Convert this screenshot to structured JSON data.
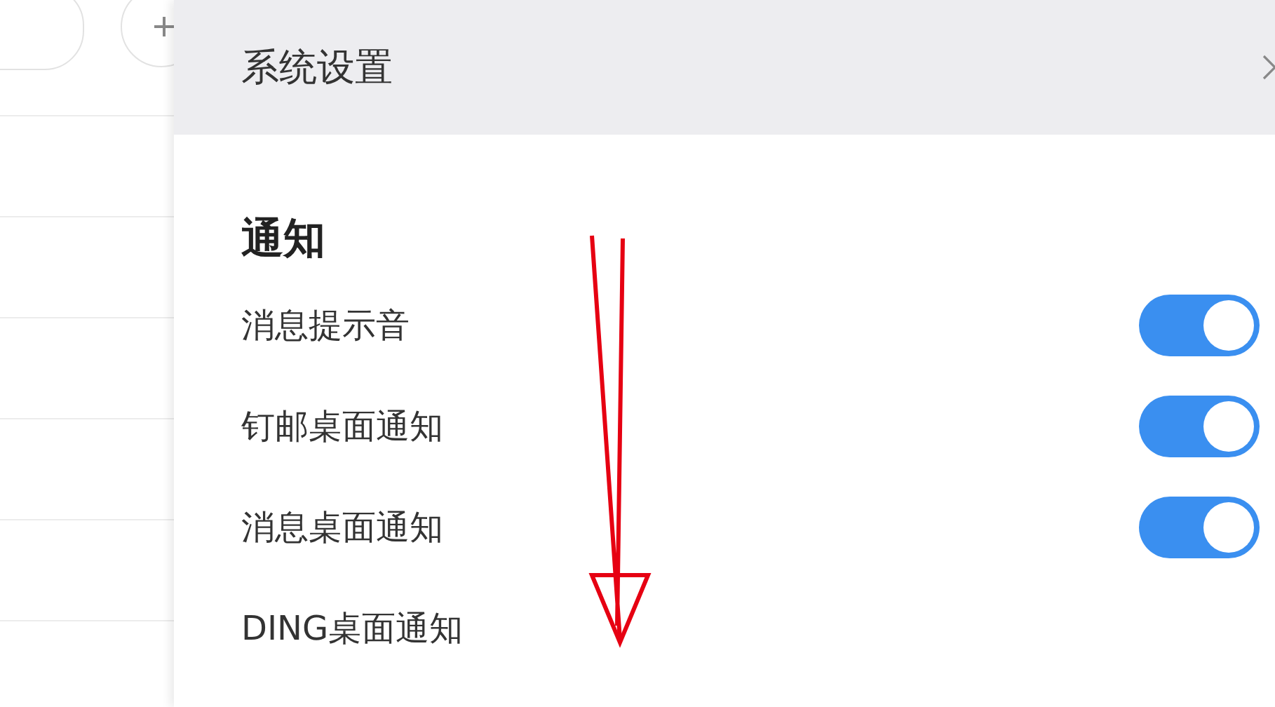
{
  "dialog": {
    "title": "系统设置"
  },
  "section": {
    "title": "通知"
  },
  "settings": [
    {
      "label": "消息提示音",
      "on": true
    },
    {
      "label": "钉邮桌面通知",
      "on": true
    },
    {
      "label": "消息桌面通知",
      "on": true
    },
    {
      "label": "DING桌面通知"
    }
  ]
}
